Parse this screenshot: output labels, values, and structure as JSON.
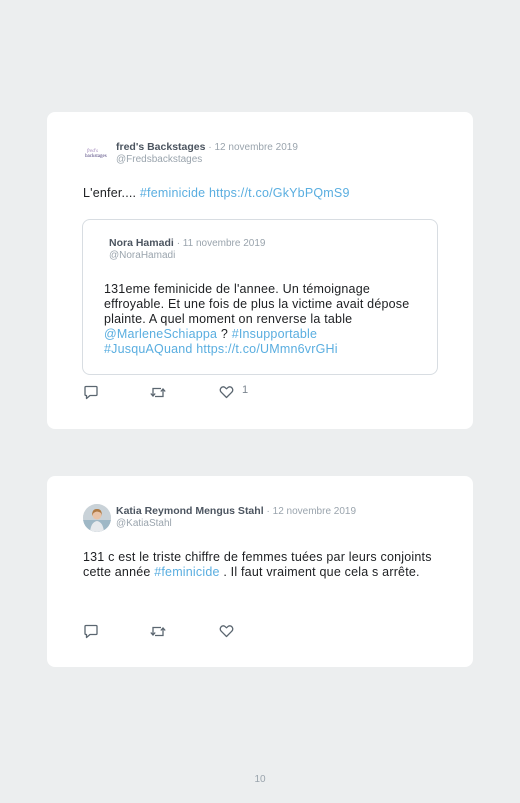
{
  "tweets": [
    {
      "author": "fred's Backstages",
      "date": "· 12 novembre 2019",
      "handle": "@Fredsbackstages",
      "avatar_text": [
        "fred's",
        "backstages"
      ],
      "text_plain": "L'enfer.... ",
      "hashtag": "#feminicide",
      "link": "https://t.co/GkYbPQmS9",
      "quote": {
        "author": "Nora Hamadi",
        "date": "· 11 novembre 2019",
        "handle": "@NoraHamadi",
        "text_plain": "131eme feminicide de l'annee. Un témoignage effroyable. Et une fois de plus la victime avait dépose plainte. A quel moment on renverse la table ",
        "mention": "@MarleneSchiappa",
        "mid": " ? ",
        "hashtag1": "#Insupportable",
        "hashtag2": "#JusquAQuand",
        "link": "https://t.co/UMmn6vrGHi"
      },
      "like_count": "1"
    },
    {
      "author": "Katia Reymond Mengus Stahl",
      "date": "· 12 novembre 2019",
      "handle": "@KatiaStahl",
      "text_plain_1": "131 c est le triste chiffre de femmes tuées par leurs conjoints cette année ",
      "hashtag": "#feminicide",
      "text_plain_2": " . Il faut vraiment que cela s arrête.",
      "like_count": ""
    }
  ],
  "page_number": "10",
  "colors": {
    "link": "#5aaee0",
    "background": "#eceeef",
    "card": "#ffffff",
    "icon": "#5b6670"
  },
  "icons": [
    "reply-icon",
    "retweet-icon",
    "like-icon"
  ]
}
